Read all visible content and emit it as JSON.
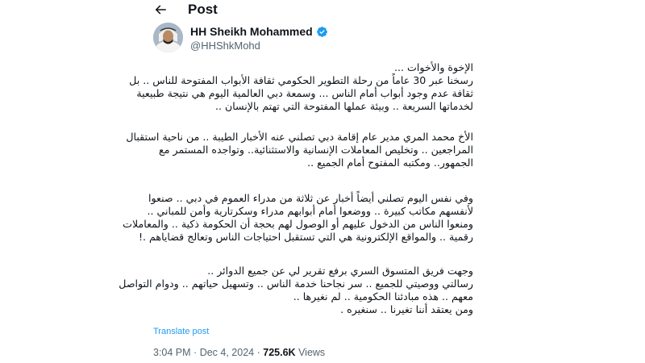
{
  "header": {
    "title": "Post",
    "back_icon": "arrow-left-icon"
  },
  "author": {
    "name": "HH Sheikh Mohammed",
    "handle": "@HHShkMohd",
    "verified_icon": "verified-badge-icon",
    "verified_color": "#1d9bf0"
  },
  "tweet": {
    "paragraphs": [
      {
        "lines": [
          "الإخوة والأخوات ...",
          "رسخنا عبر 30 عاماً من رحلة التطوير الحكومي ثقافة الأبواب المفتوحة للناس .. بل",
          "ثقافة عدم وجود أبواب أمام الناس ... وسمعة دبي العالمية اليوم هي نتيجة طبيعية",
          "لخدماتها السريعة .. وبيئة عملها المفتوحة التي تهتم بالإنسان .."
        ]
      },
      {
        "lines": [
          "الأخ محمد المري مدير عام إقامة دبي تصلني عنه الأخبار الطيبة .. من ناحية استقبال",
          "المراجعين .. وتخليص المعاملات الإنسانية والاستثنائية.. وتواجده المستمر مع",
          "الجمهور.. ومكتبه المفتوح أمام الجميع .."
        ]
      },
      {
        "lines": [
          "وفي نفس اليوم تصلني أيضاً أخبار عن ثلاثة من مدراء العموم في دبي .. صنعوا",
          "لأنفسهم مكاتب كبيرة .. ووضعوا أمام أبوابهم مدراء وسكرتارية وأمن للمباني ..",
          "ومنعوا الناس من الدخول عليهم أو الوصول لهم بحجة أن الحكومة ذكية .. والمعاملات",
          "رقمية .. والمواقع الإلكترونية هي التي تستقبل احتياجات الناس وتعالج قضاياهم .!"
        ]
      },
      {
        "lines": [
          "وجهت فريق المتسوق السري برفع تقرير لي عن جميع الدوائر ..",
          "رسالتي ووصيتي للجميع .. سر نجاحنا خدمة الناس .. وتسهيل حياتهم .. ودوام التواصل",
          "معهم .. هذه مبادئنا الحكومية .. لم نغيرها ..",
          "ومن يعتقد أننا تغيرنا .. سنغيره ."
        ]
      }
    ]
  },
  "translate_label": "Translate post",
  "meta": {
    "time": "3:04 PM",
    "sep1": "·",
    "date": "Dec 4, 2024",
    "sep2": "·",
    "views_count": "725.6K",
    "views_label": "Views"
  },
  "colors": {
    "text_primary": "#0f1419",
    "text_secondary": "#536471",
    "link": "#1d9bf0",
    "background": "#ffffff"
  }
}
